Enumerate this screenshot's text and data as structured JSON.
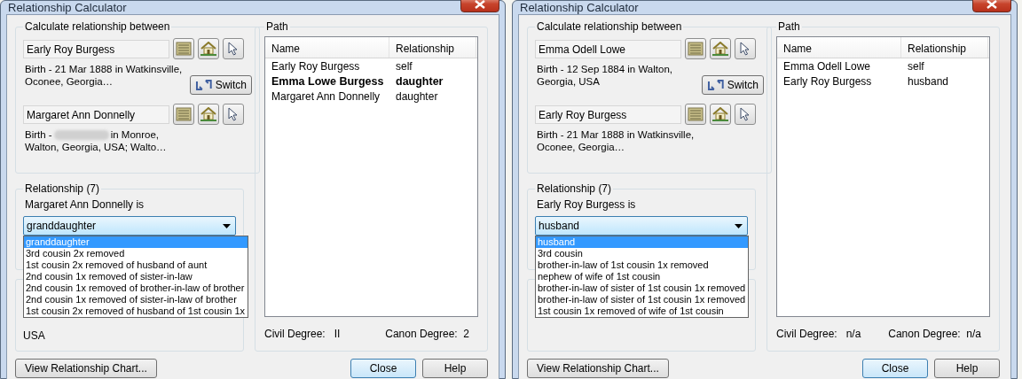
{
  "dialogs": [
    {
      "title": "Relationship Calculator",
      "people_group": {
        "title": "Calculate relationship between",
        "switch_label": "Switch",
        "people": [
          {
            "name": "Early Roy Burgess",
            "birth": "Birth - 21 Mar 1888 in Watkinsville, Oconee, Georgia…"
          },
          {
            "name": "Margaret Ann Donnelly",
            "birth": "Birth -",
            "birth_rest": "in Monroe, Walton, Georgia, USA; Walto…"
          }
        ]
      },
      "relationship_group": {
        "title": "Relationship (7)",
        "prompt": "Margaret Ann Donnelly is",
        "value": "granddaughter",
        "options": [
          {
            "label": "granddaughter",
            "selected": true
          },
          {
            "label": "3rd cousin 2x removed",
            "selected": false
          },
          {
            "label": "1st cousin 2x removed of husband of aunt",
            "selected": false
          },
          {
            "label": "2nd cousin 1x removed of sister-in-law",
            "selected": false
          },
          {
            "label": "2nd cousin 1x removed of brother-in-law of brother",
            "selected": false
          },
          {
            "label": "2nd cousin 1x removed of sister-in-law of brother",
            "selected": false
          },
          {
            "label": "1st cousin 2x removed of husband of 1st cousin 1x",
            "selected": false
          }
        ]
      },
      "details_text": "USA",
      "path": {
        "title": "Path",
        "columns": [
          "Name",
          "Relationship"
        ],
        "rows": [
          {
            "name": "Early Roy Burgess",
            "relationship": "self",
            "bold": false
          },
          {
            "name": "Emma Lowe Burgess",
            "relationship": "daughter",
            "bold": true
          },
          {
            "name": "Margaret Ann Donnelly",
            "relationship": "daughter",
            "bold": false
          }
        ],
        "civil_label": "Civil Degree:",
        "civil_value": "II",
        "canon_label": "Canon Degree:",
        "canon_value": "2"
      },
      "chart_button": "View Relationship Chart...",
      "close_button": "Close",
      "help_button": "Help"
    },
    {
      "title": "Relationship Calculator",
      "people_group": {
        "title": "Calculate relationship between",
        "switch_label": "Switch",
        "people": [
          {
            "name": "Emma Odell Lowe",
            "birth": "Birth - 12 Sep 1884 in Walton, Georgia, USA"
          },
          {
            "name": "Early Roy Burgess",
            "birth": "Birth - 21 Mar 1888 in Watkinsville, Oconee, Georgia…"
          }
        ]
      },
      "relationship_group": {
        "title": "Relationship (7)",
        "prompt": "Early Roy Burgess is",
        "value": "husband",
        "options": [
          {
            "label": "husband",
            "selected": true
          },
          {
            "label": "3rd cousin",
            "selected": false
          },
          {
            "label": "brother-in-law of 1st cousin 1x removed",
            "selected": false
          },
          {
            "label": "nephew of wife of 1st cousin",
            "selected": false
          },
          {
            "label": "brother-in-law of sister of 1st cousin 1x removed",
            "selected": false
          },
          {
            "label": "brother-in-law of sister of 1st cousin 1x removed",
            "selected": false
          },
          {
            "label": "1st cousin 1x removed of wife of 1st cousin",
            "selected": false
          }
        ]
      },
      "path": {
        "title": "Path",
        "columns": [
          "Name",
          "Relationship"
        ],
        "rows": [
          {
            "name": "Emma Odell Lowe",
            "relationship": "self",
            "bold": false
          },
          {
            "name": "Early Roy Burgess",
            "relationship": "husband",
            "bold": false
          }
        ],
        "civil_label": "Civil Degree:",
        "civil_value": "n/a",
        "canon_label": "Canon Degree:",
        "canon_value": "n/a"
      },
      "chart_button": "View Relationship Chart...",
      "close_button": "Close",
      "help_button": "Help"
    }
  ]
}
